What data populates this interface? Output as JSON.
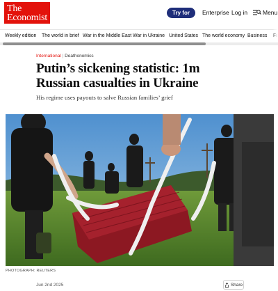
{
  "header": {
    "logo_line1": "The",
    "logo_line2": "Economist",
    "try_button": "Try for free",
    "enterprise": "Enterprise",
    "login": "Log in",
    "menu": "Menu",
    "logo_color": "#e3120b",
    "try_button_color": "#1f2e7a"
  },
  "nav": {
    "items": [
      "Weekly edition",
      "The world in brief",
      "War in the Middle East",
      "War in Ukraine",
      "United States",
      "The world economy",
      "Business",
      "Fi"
    ]
  },
  "article": {
    "section": "International",
    "separator": "|",
    "subsection": "Deathonomics",
    "headline": "Putin’s sickening statistic: 1m Russian casualties in Ukraine",
    "subheadline": "His regime uses payouts to salve Russian families’ grief",
    "photo_credit": "PHOTOGRAPH: REUTERS",
    "date": "Jun 2nd 2025",
    "share": "Share"
  }
}
